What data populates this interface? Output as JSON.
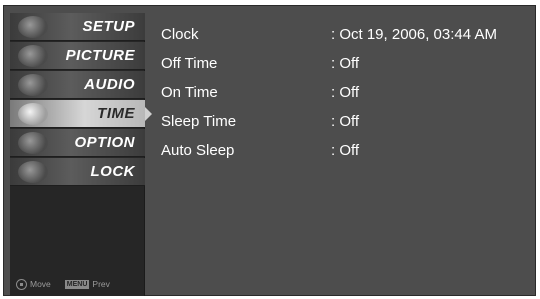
{
  "sidebar": {
    "items": [
      {
        "label": "SETUP",
        "icon": "setup-icon",
        "active": false
      },
      {
        "label": "PICTURE",
        "icon": "picture-icon",
        "active": false
      },
      {
        "label": "AUDIO",
        "icon": "audio-icon",
        "active": false
      },
      {
        "label": "TIME",
        "icon": "time-icon",
        "active": true
      },
      {
        "label": "OPTION",
        "icon": "option-icon",
        "active": false
      },
      {
        "label": "LOCK",
        "icon": "lock-icon",
        "active": false
      }
    ]
  },
  "footer": {
    "move_label": "Move",
    "menu_chip": "MENU",
    "prev_label": "Prev"
  },
  "settings": {
    "rows": [
      {
        "label": "Clock",
        "value": ": Oct 19, 2006, 03:44 AM"
      },
      {
        "label": "Off Time",
        "value": ": Off"
      },
      {
        "label": "On Time",
        "value": ": Off"
      },
      {
        "label": "Sleep Time",
        "value": ": Off"
      },
      {
        "label": "Auto Sleep",
        "value": ": Off"
      }
    ]
  },
  "colors": {
    "panel_background": "#4d4d4d",
    "sidebar_background": "#262626",
    "active_item": "#d6d6d6",
    "text": "#ffffff"
  }
}
